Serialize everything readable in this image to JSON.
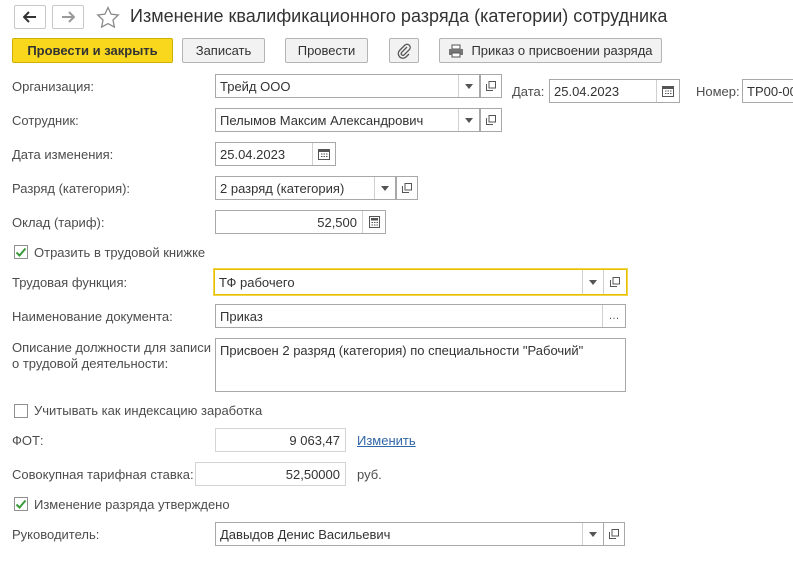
{
  "header": {
    "title": "Изменение квалификационного разряда (категории) сотрудника"
  },
  "toolbar": {
    "post_close": "Провести и закрыть",
    "save": "Записать",
    "post": "Провести",
    "order": "Приказ о присвоении разряда"
  },
  "form": {
    "org_label": "Организация:",
    "org_value": "Трейд ООО",
    "date_label": "Дата:",
    "date_value": "25.04.2023",
    "number_label": "Номер:",
    "number_value": "ТР00-00",
    "employee_label": "Сотрудник:",
    "employee_value": "Пелымов Максим Александрович",
    "change_date_label": "Дата изменения:",
    "change_date_value": "25.04.2023",
    "grade_label": "Разряд (категория):",
    "grade_value": "2 разряд (категория)",
    "salary_label": "Оклад (тариф):",
    "salary_value": "52,500",
    "workbook_label": "Отразить в трудовой книжке",
    "workbook_checked": true,
    "labor_function_label": "Трудовая функция:",
    "labor_function_value": "ТФ рабочего",
    "doc_name_label": "Наименование документа:",
    "doc_name_value": "Приказ",
    "description_label_1": "Описание должности для записи",
    "description_label_2": "о трудовой деятельности:",
    "description_value": "Присвоен 2 разряд (категория) по специальности \"Рабочий\"",
    "indexation_label": "Учитывать как индексацию заработка",
    "indexation_checked": false,
    "fot_label": "ФОТ:",
    "fot_value": "9 063,47",
    "fot_change_link": "Изменить",
    "total_rate_label": "Совокупная тарифная ставка:",
    "total_rate_value": "52,50000",
    "total_rate_unit": "руб.",
    "approved_label": "Изменение разряда утверждено",
    "approved_checked": true,
    "manager_label": "Руководитель:",
    "manager_value": "Давыдов Денис Васильевич"
  },
  "colors": {
    "primary_button": "#f9d71c",
    "link": "#3166a8",
    "focus_border": "#e5c100",
    "check": "#3a9a3a"
  }
}
